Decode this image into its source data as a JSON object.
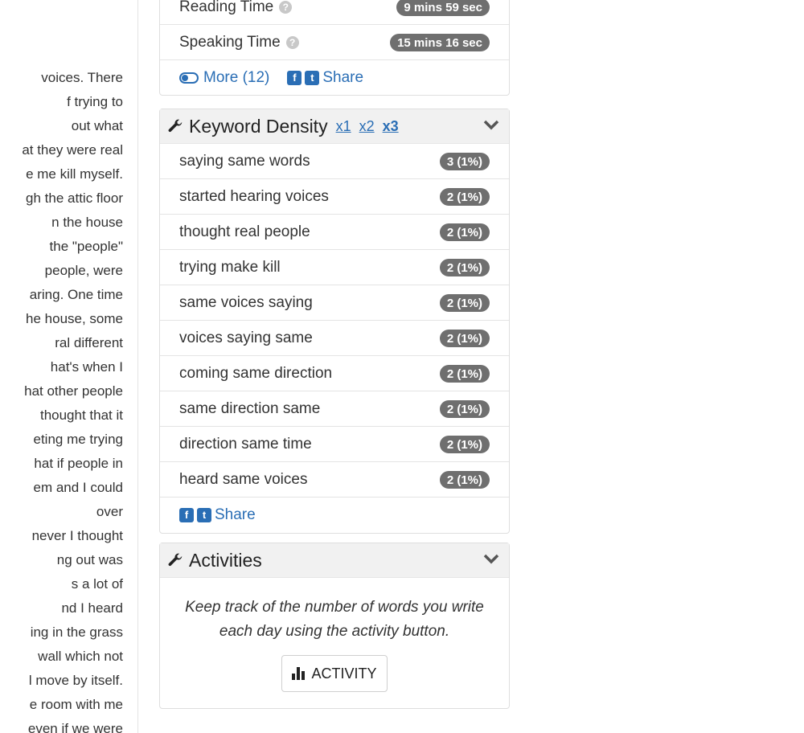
{
  "article": {
    "lines": [
      "voices. There",
      "f trying to",
      "out what",
      "at they were real",
      "e me kill myself.",
      "gh the attic floor",
      "n the house",
      "the \"people\"",
      "people, were",
      "aring. One time",
      "he house, some",
      "ral different",
      "hat's when I",
      "hat other people",
      "thought that it",
      "eting me trying",
      "hat if people in",
      "em and I could",
      "over",
      "never I thought",
      "ng out was",
      "s a lot of",
      "nd I heard",
      "ing in the grass",
      "wall which not",
      "l move by itself.",
      "e room with me",
      "even if we were"
    ]
  },
  "stats": {
    "reading_label": "Reading Time",
    "reading_value": "9 mins 59 sec",
    "speaking_label": "Speaking Time",
    "speaking_value": "15 mins 16 sec",
    "more_label": "More (12)",
    "share_label": "Share"
  },
  "keyword_density": {
    "title": "Keyword Density",
    "multipliers": [
      "x1",
      "x2",
      "x3"
    ],
    "active_multiplier": "x3",
    "items": [
      {
        "phrase": "saying same words",
        "count": "3 (1%)"
      },
      {
        "phrase": "started hearing voices",
        "count": "2 (1%)"
      },
      {
        "phrase": "thought real people",
        "count": "2 (1%)"
      },
      {
        "phrase": "trying make kill",
        "count": "2 (1%)"
      },
      {
        "phrase": "same voices saying",
        "count": "2 (1%)"
      },
      {
        "phrase": "voices saying same",
        "count": "2 (1%)"
      },
      {
        "phrase": "coming same direction",
        "count": "2 (1%)"
      },
      {
        "phrase": "same direction same",
        "count": "2 (1%)"
      },
      {
        "phrase": "direction same time",
        "count": "2 (1%)"
      },
      {
        "phrase": "heard same voices",
        "count": "2 (1%)"
      }
    ],
    "share_label": "Share"
  },
  "activities": {
    "title": "Activities",
    "description": "Keep track of the number of words you write each day using the activity button.",
    "button_label": "ACTIVITY"
  },
  "colors": {
    "link": "#2a6eb5",
    "badge": "#6f6f6f",
    "panel_header": "#f1f1f1"
  },
  "icons": [
    "help-icon",
    "toggle-icon",
    "facebook-icon",
    "twitter-icon",
    "wrench-icon",
    "chevron-down-icon",
    "bar-chart-icon"
  ]
}
